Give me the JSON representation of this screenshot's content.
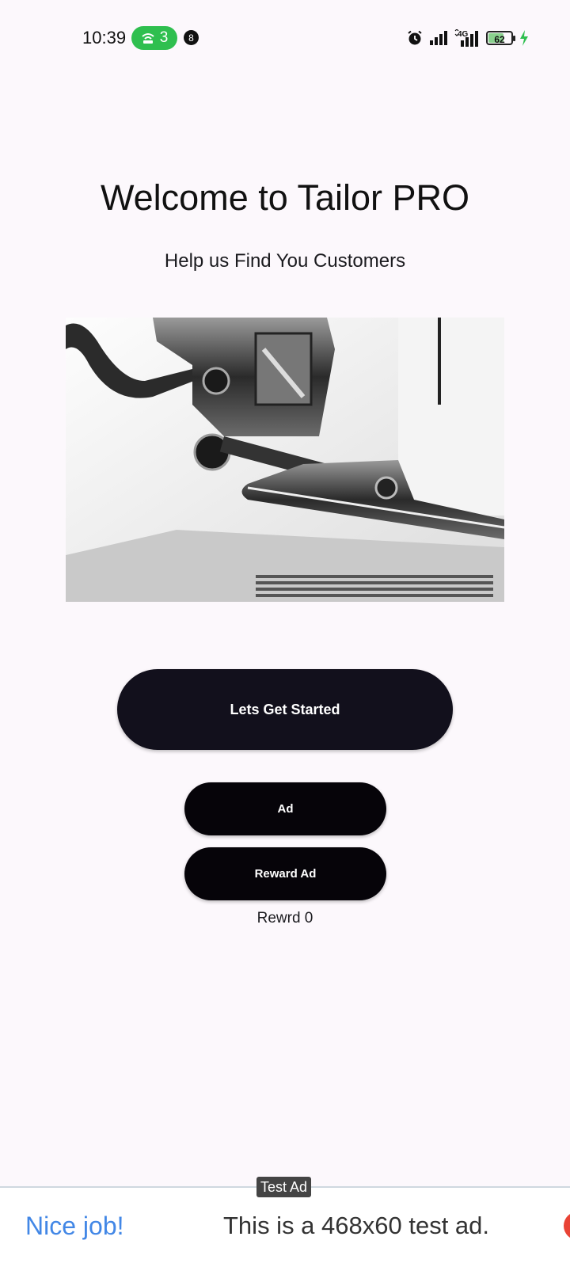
{
  "status_bar": {
    "time": "10:39",
    "hotspot_count": "3",
    "notification_count": "8",
    "network": "4G",
    "battery": "62",
    "icons": [
      "alarm-icon",
      "signal-icon",
      "signal-4g-icon",
      "battery-icon",
      "charging-icon",
      "hotspot-icon"
    ]
  },
  "main": {
    "title": "Welcome to Tailor PRO",
    "subtitle": "Help us Find You Customers",
    "hero_image": "sewing-machine-presser-foot"
  },
  "buttons": {
    "get_started": "Lets Get Started",
    "ad": "Ad",
    "reward_ad": "Reward Ad"
  },
  "reward_label": "Rewrd 0",
  "ad_banner": {
    "tag": "Test Ad",
    "headline": "Nice job!",
    "text": "This is a 468x60 test ad.",
    "headline_color": "#4287e6"
  },
  "colors": {
    "background": "#fcf8fc",
    "primary_button": "#12101c",
    "secondary_button": "#060409",
    "hotspot_pill": "#2fbf4f"
  }
}
